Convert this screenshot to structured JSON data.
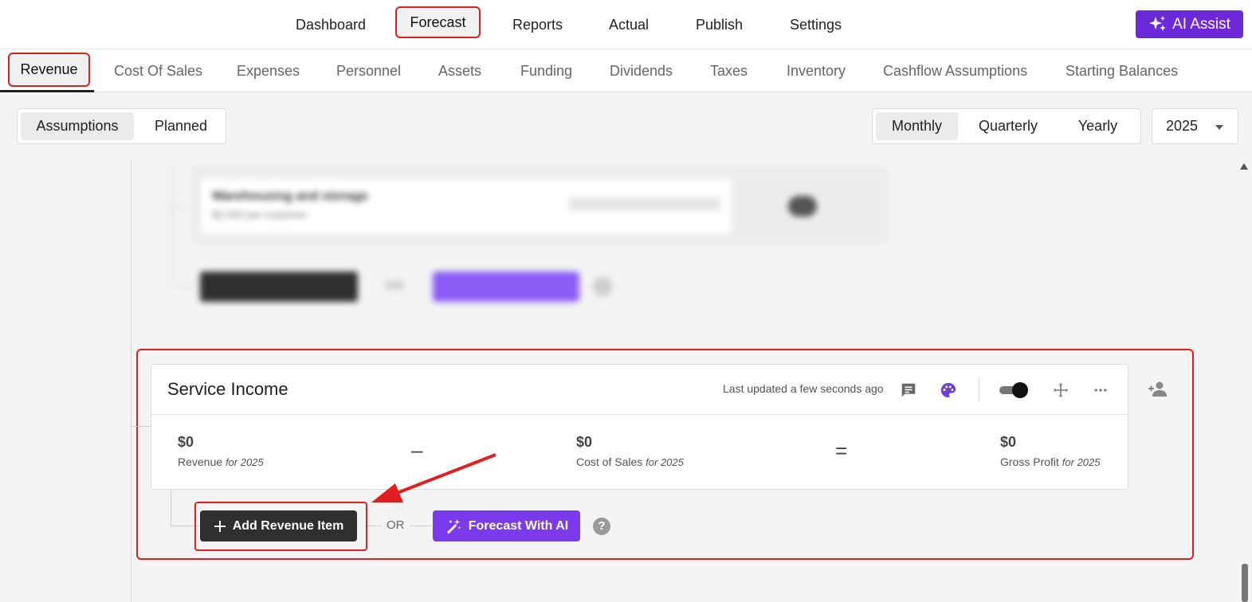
{
  "topnav": {
    "items": [
      "Dashboard",
      "Forecast",
      "Reports",
      "Actual",
      "Publish",
      "Settings"
    ],
    "active": "Forecast",
    "ai_assist_label": "AI Assist"
  },
  "subtabs": {
    "items": [
      "Revenue",
      "Cost Of Sales",
      "Expenses",
      "Personnel",
      "Assets",
      "Funding",
      "Dividends",
      "Taxes",
      "Inventory",
      "Cashflow Assumptions",
      "Starting Balances"
    ],
    "active": "Revenue"
  },
  "mode_toggle": {
    "items": [
      "Assumptions",
      "Planned"
    ],
    "selected": "Assumptions"
  },
  "period_toggle": {
    "items": [
      "Monthly",
      "Quarterly",
      "Yearly"
    ],
    "selected": "Monthly"
  },
  "year_select": {
    "value": "2025"
  },
  "blurred_item": {
    "title": "Warehousing and storage",
    "subtitle": "$2,000 per customer"
  },
  "card": {
    "title": "Service Income",
    "last_updated": "Last updated a few seconds ago",
    "metrics": [
      {
        "value": "$0",
        "label": "Revenue",
        "period": "for 2025"
      },
      {
        "value": "$0",
        "label": "Cost of Sales",
        "period": "for 2025"
      },
      {
        "value": "$0",
        "label": "Gross Profit",
        "period": "for 2025"
      }
    ],
    "operators": [
      "–",
      "="
    ]
  },
  "actions": {
    "add_label": "Add Revenue Item",
    "or_label": "OR",
    "ai_label": "Forecast With AI",
    "help_label": "?"
  },
  "colors": {
    "accent_purple": "#7c3aed",
    "highlight_red": "#e02020",
    "dark_button": "#2f2f2f"
  }
}
